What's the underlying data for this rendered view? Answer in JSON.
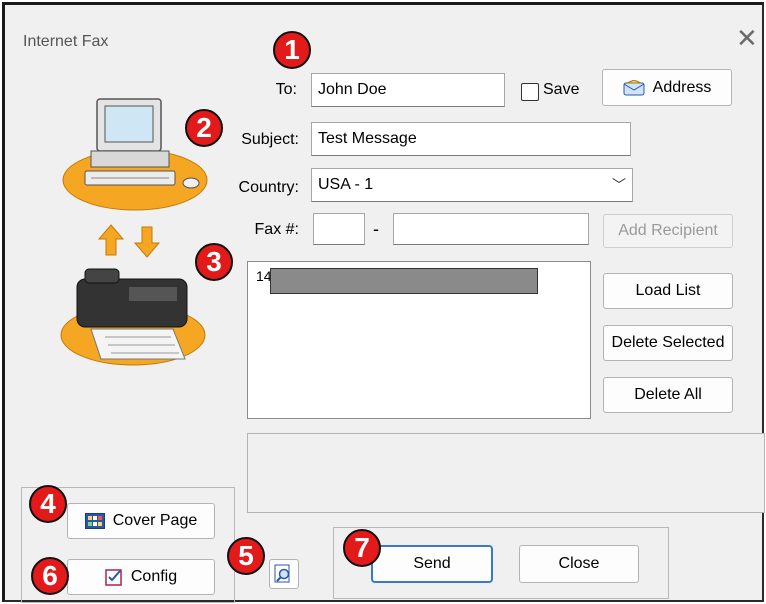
{
  "window": {
    "title": "Internet Fax"
  },
  "form": {
    "to_label": "To:",
    "to_value": "John Doe",
    "save_label": "Save",
    "save_checked": false,
    "address_button": "Address",
    "subject_label": "Subject:",
    "subject_value": "Test Message",
    "country_label": "Country:",
    "country_value": "USA - 1",
    "fax_label": "Fax #:",
    "fax_area": "",
    "fax_dash": "-",
    "fax_number": "",
    "add_recipient_button": "Add Recipient"
  },
  "recipients": {
    "items": [
      {
        "visible_prefix": "14"
      }
    ]
  },
  "list_buttons": {
    "load": "Load List",
    "delete_selected": "Delete Selected",
    "delete_all": "Delete All"
  },
  "bottom": {
    "cover_page": "Cover Page",
    "config": "Config",
    "send": "Send",
    "close": "Close"
  },
  "badges": [
    "1",
    "2",
    "3",
    "4",
    "5",
    "6",
    "7"
  ],
  "colors": {
    "badge_red": "#e21a1a",
    "default_button_border": "#3a78c8",
    "illustration_orange": "#f5a623"
  },
  "icons": {
    "address": "envelope-icon",
    "cover_page": "grid-icon",
    "config": "checklist-icon",
    "preview": "magnifier-icon",
    "close": "close-icon",
    "dropdown": "chevron-down-icon"
  }
}
